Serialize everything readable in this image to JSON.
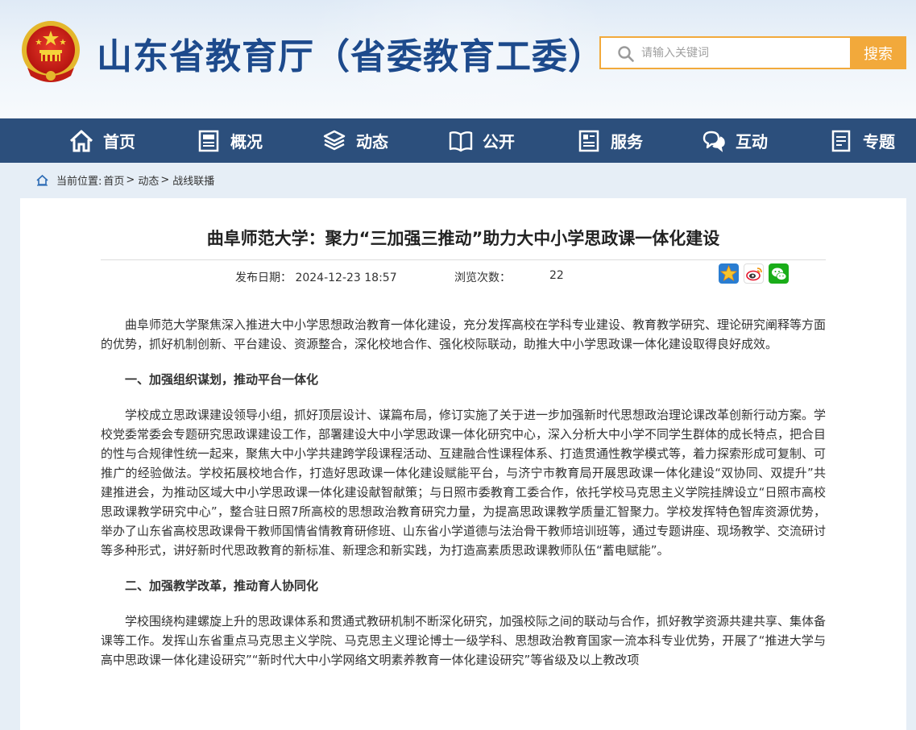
{
  "header": {
    "site_title": "山东省教育厅（省委教育工委）",
    "search_placeholder": "请输入关键词",
    "search_button": "搜索"
  },
  "nav": [
    {
      "label": "首页",
      "icon": "home-icon"
    },
    {
      "label": "概况",
      "icon": "overview-icon"
    },
    {
      "label": "动态",
      "icon": "news-stack-icon"
    },
    {
      "label": "公开",
      "icon": "open-book-icon"
    },
    {
      "label": "服务",
      "icon": "service-doc-icon"
    },
    {
      "label": "互动",
      "icon": "chat-bubbles-icon"
    },
    {
      "label": "专题",
      "icon": "topic-doc-icon"
    }
  ],
  "breadcrumb": {
    "prefix": "当前位置:",
    "items": [
      "首页",
      "动态",
      "战线联播"
    ]
  },
  "article": {
    "title": "曲阜师范大学：聚力“三加强三推动”助力大中小学思政课一体化建设",
    "publish_label": "发布日期：",
    "publish_date": "2024-12-23 18:57",
    "views_label": "浏览次数：",
    "views": "22",
    "share": [
      "qzone-icon",
      "weibo-icon",
      "wechat-icon"
    ],
    "paragraphs": [
      {
        "type": "p",
        "text": "曲阜师范大学聚焦深入推进大中小学思想政治教育一体化建设，充分发挥高校在学科专业建设、教育教学研究、理论研究阐释等方面的优势，抓好机制创新、平台建设、资源整合，深化校地合作、强化校际联动，助推大中小学思政课一体化建设取得良好成效。"
      },
      {
        "type": "h",
        "text": "一、加强组织谋划，推动平台一体化"
      },
      {
        "type": "p",
        "text": "学校成立思政课建设领导小组，抓好顶层设计、谋篇布局，修订实施了关于进一步加强新时代思想政治理论课改革创新行动方案。学校党委常委会专题研究思政课建设工作，部署建设大中小学思政课一体化研究中心，深入分析大中小学不同学生群体的成长特点，把合目的性与合规律性统一起来，聚焦大中小学共建跨学段课程活动、互建融合性课程体系、打造贯通性教学模式等，着力探索形成可复制、可推广的经验做法。学校拓展校地合作，打造好思政课一体化建设赋能平台，与济宁市教育局开展思政课一体化建设“双协同、双提升”共建推进会，为推动区域大中小学思政课一体化建设献智献策；与日照市委教育工委合作，依托学校马克思主义学院挂牌设立“日照市高校思政课教学研究中心”，整合驻日照7所高校的思想政治教育研究力量，为提高思政课教学质量汇智聚力。学校发挥特色智库资源优势，举办了山东省高校思政课骨干教师国情省情教育研修班、山东省小学道德与法治骨干教师培训班等，通过专题讲座、现场教学、交流研讨等多种形式，讲好新时代思政教育的新标准、新理念和新实践，为打造高素质思政课教师队伍“蓄电赋能”。"
      },
      {
        "type": "h",
        "text": "二、加强教学改革，推动育人协同化"
      },
      {
        "type": "p",
        "text": "学校围绕构建螺旋上升的思政课体系和贯通式教研机制不断深化研究，加强校际之间的联动与合作，抓好教学资源共建共享、集体备课等工作。发挥山东省重点马克思主义学院、马克思主义理论博士一级学科、思想政治教育国家一流本科专业优势，开展了“推进大学与高中思政课一体化建设研究”“新时代大中小学网络文明素养教育一体化建设研究”等省级及以上教改项"
      }
    ]
  }
}
